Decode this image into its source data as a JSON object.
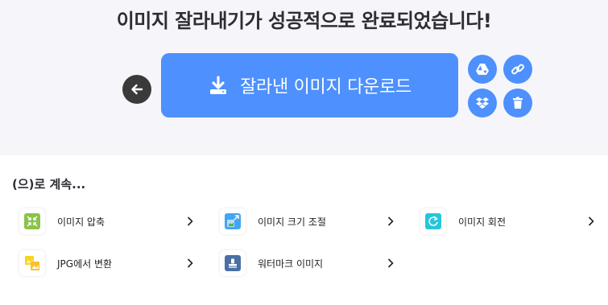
{
  "header": {
    "title": "이미지 잘라내기가 성공적으로 완료되었습니다!"
  },
  "actions": {
    "back_icon": "arrow-left-icon",
    "download_label": "잘라낸 이미지 다운로드",
    "download_icon": "download-icon",
    "side_buttons": [
      {
        "name": "google-drive",
        "icon": "google-drive-icon"
      },
      {
        "name": "copy-link",
        "icon": "link-icon"
      },
      {
        "name": "dropbox",
        "icon": "dropbox-icon"
      },
      {
        "name": "delete",
        "icon": "trash-icon"
      }
    ]
  },
  "continue": {
    "title": "(으)로 계속...",
    "tools": [
      {
        "label": "이미지 압축",
        "icon": "compress-icon",
        "color": "#8bc34a"
      },
      {
        "label": "이미지 크기 조절",
        "icon": "resize-icon",
        "color": "#42a5f5"
      },
      {
        "label": "이미지 회전",
        "icon": "rotate-icon",
        "color": "#26c6da"
      },
      {
        "label": "JPG에서 변환",
        "icon": "convert-from-jpg-icon",
        "color": "#f9d423"
      },
      {
        "label": "워터마크 이미지",
        "icon": "watermark-icon",
        "color": "#4a6fa5"
      }
    ]
  },
  "colors": {
    "primary": "#4d90fe",
    "top_background": "#f5f5fa",
    "back_button": "#3a3a3a"
  }
}
